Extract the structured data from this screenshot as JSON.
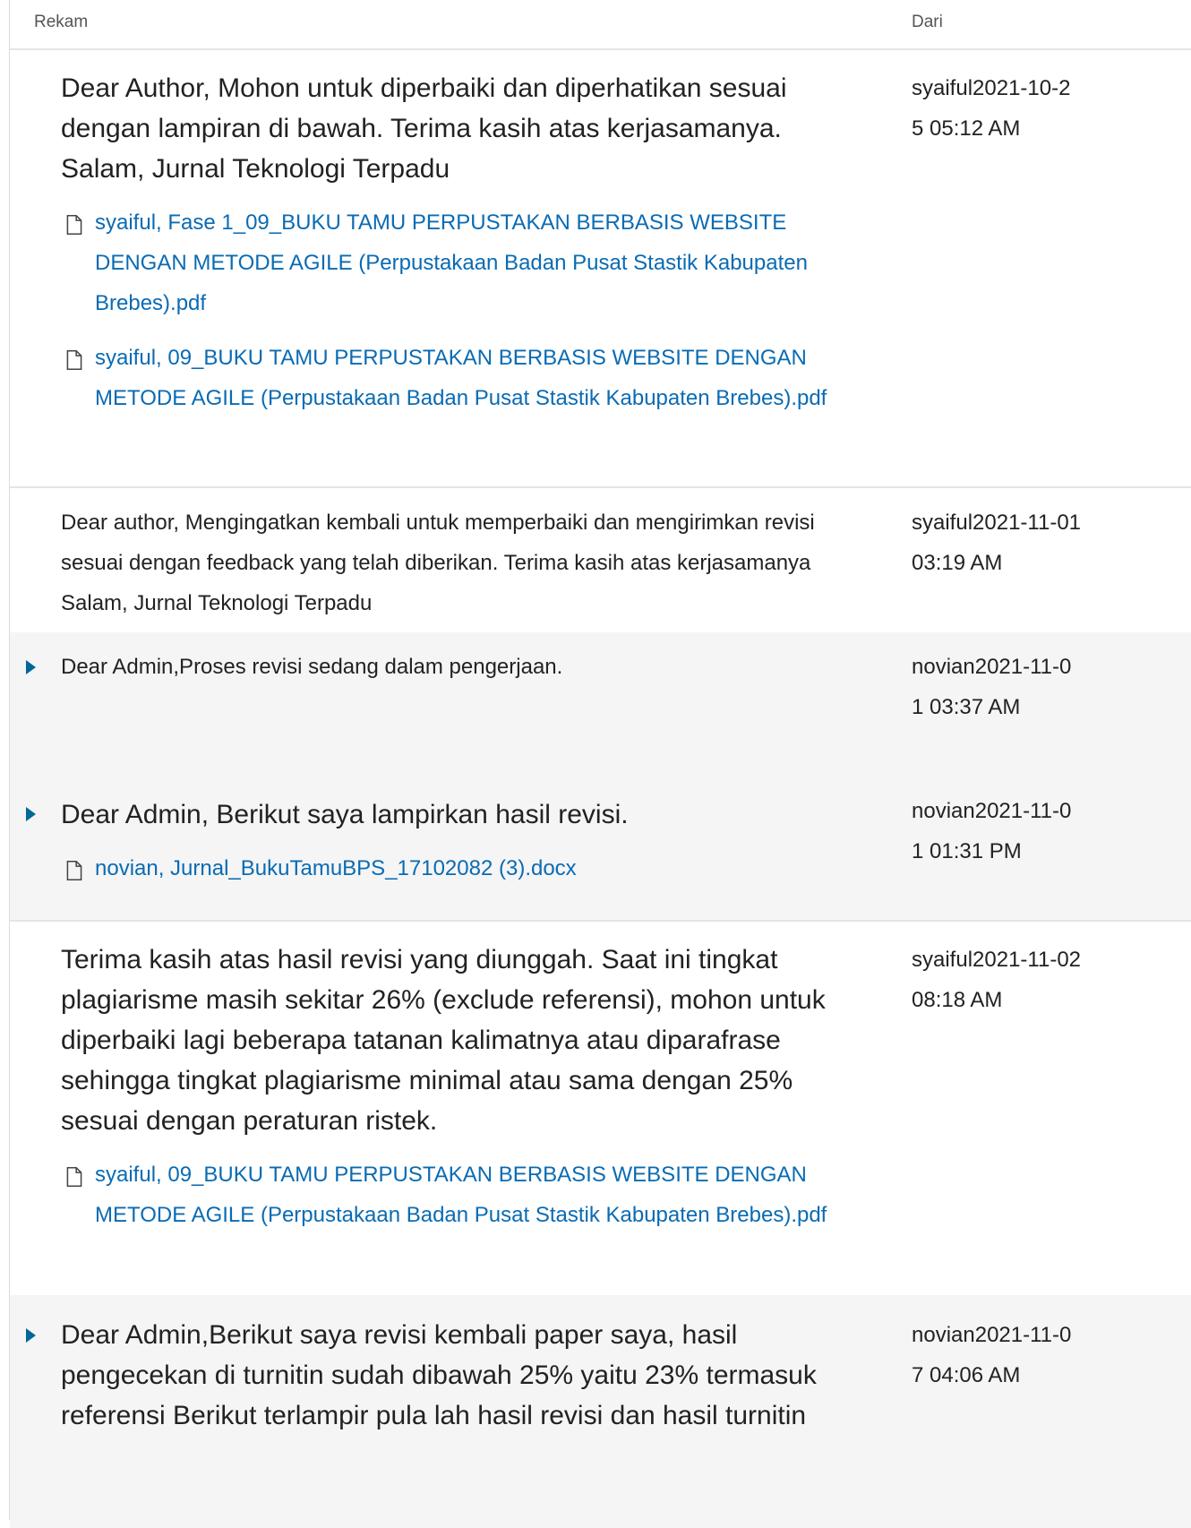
{
  "header": {
    "rekam_label": "Rekam",
    "dari_label": "Dari"
  },
  "rows": [
    {
      "text": "Dear Author, Mohon untuk diperbaiki dan diperhatikan sesuai dengan lampiran di bawah. Terima kasih atas kerjasamanya. Salam, Jurnal Teknologi Terpadu",
      "from": "syaiful2021-10-25 05:12 AM",
      "attachments": [
        "syaiful, Fase 1_09_BUKU TAMU PERPUSTAKAN BERBASIS WEBSITE DENGAN METODE AGILE (Perpustakaan Badan Pusat Stastik Kabupaten Brebes).pdf",
        "syaiful, 09_BUKU TAMU PERPUSTAKAN BERBASIS WEBSITE DENGAN METODE AGILE (Perpustakaan Badan Pusat Stastik Kabupaten Brebes).pdf"
      ]
    },
    {
      "text": "Dear author, Mengingatkan kembali untuk memperbaiki dan mengirimkan revisi sesuai dengan feedback yang telah diberikan. Terima kasih atas kerjasamanya Salam, Jurnal Teknologi Terpadu",
      "from": "syaiful2021-11-01 03:19 AM",
      "attachments": []
    },
    {
      "text": "Dear Admin,Proses revisi sedang dalam pengerjaan.",
      "from": "novian2021-11-01 03:37 AM",
      "attachments": []
    },
    {
      "text": "Dear Admin, Berikut saya lampirkan hasil revisi.",
      "from": "novian2021-11-01 01:31 PM",
      "attachments": [
        "novian, Jurnal_BukuTamuBPS_17102082 (3).docx"
      ]
    },
    {
      "text": "Terima kasih atas hasil revisi yang diunggah. Saat ini tingkat plagiarisme masih sekitar 26% (exclude referensi), mohon untuk diperbaiki lagi beberapa tatanan kalimatnya atau diparafrase sehingga tingkat plagiarisme minimal atau sama dengan 25% sesuai dengan peraturan ristek.",
      "from": "syaiful2021-11-02 08:18 AM",
      "attachments": [
        "syaiful, 09_BUKU TAMU PERPUSTAKAN BERBASIS WEBSITE DENGAN METODE AGILE (Perpustakaan Badan Pusat Stastik Kabupaten Brebes).pdf"
      ]
    },
    {
      "text": "Dear Admin,Berikut saya revisi kembali paper saya, hasil pengecekan di turnitin sudah dibawah 25% yaitu 23% termasuk referensi Berikut terlampir pula lah hasil revisi dan hasil turnitin",
      "from": "novian2021-11-07 04:06 AM",
      "attachments": []
    }
  ]
}
